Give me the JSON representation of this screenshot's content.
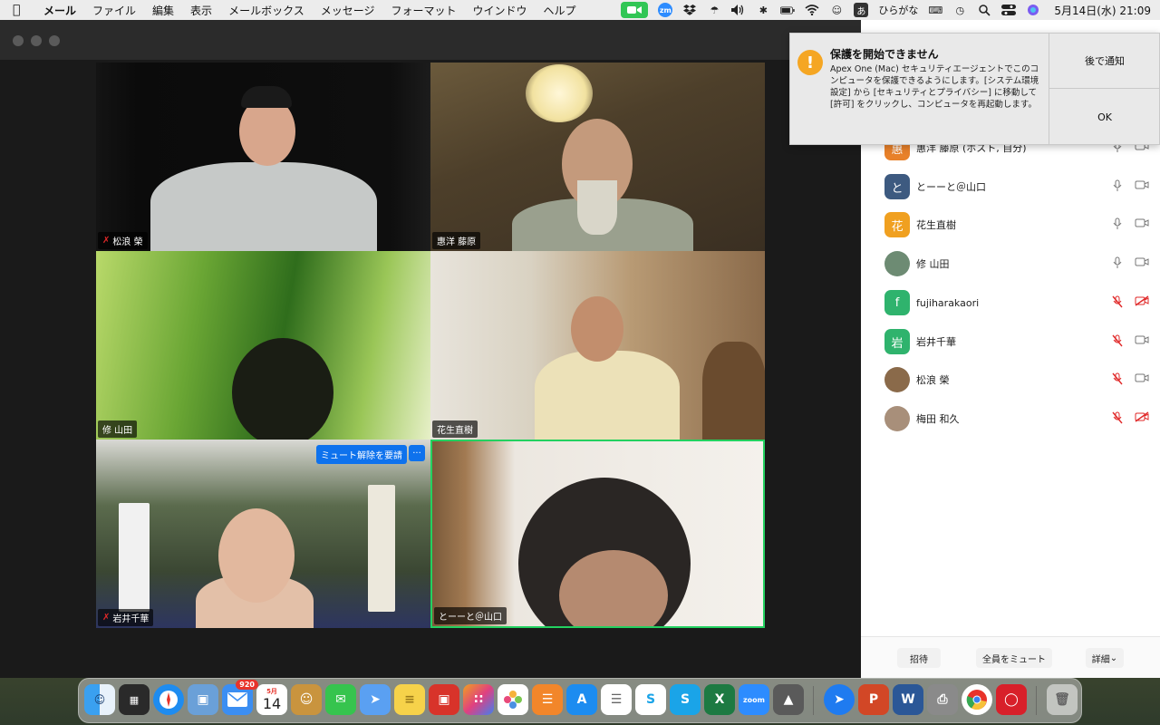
{
  "menubar": {
    "app": "メール",
    "items": [
      "ファイル",
      "編集",
      "表示",
      "メールボックス",
      "メッセージ",
      "フォーマット",
      "ウインドウ",
      "ヘルプ"
    ],
    "ime": "あ",
    "ime_label": "ひらがな",
    "zm": "zm",
    "datetime": "5月14日(水)  21:09"
  },
  "video": {
    "tiles": [
      {
        "name": "松浪 榮",
        "muted": true
      },
      {
        "name": "惠洋 藤原",
        "muted": false
      },
      {
        "name": "修 山田",
        "muted": false
      },
      {
        "name": "花生直樹",
        "muted": false
      },
      {
        "name": "岩井千華",
        "muted": true,
        "ask_unmute": "ミュート解除を要請",
        "more": "···"
      },
      {
        "name": "とーーと＠山口",
        "muted": false,
        "active": true
      }
    ]
  },
  "participants": [
    {
      "initial": "惠",
      "name": "惠洋 藤原 (ホスト, 自分)",
      "color": "#e8812a",
      "mic_muted": false,
      "cam_off": false
    },
    {
      "initial": "と",
      "name": "とーーと＠山口",
      "color": "#3d5a80",
      "mic_muted": false,
      "cam_off": false
    },
    {
      "initial": "花",
      "name": "花生直樹",
      "color": "#f0a020",
      "mic_muted": false,
      "cam_off": false
    },
    {
      "initial": "",
      "name": "修 山田",
      "color": "#6d8b73",
      "mic_muted": false,
      "cam_off": false
    },
    {
      "initial": "f",
      "name": "fujiharakaori",
      "color": "#2fb36d",
      "mic_muted": true,
      "cam_off": true
    },
    {
      "initial": "岩",
      "name": "岩井千華",
      "color": "#2fb36d",
      "mic_muted": true,
      "cam_off": false
    },
    {
      "initial": "",
      "name": "松浪 榮",
      "color": "#8a6a4a",
      "mic_muted": true,
      "cam_off": false
    },
    {
      "initial": "",
      "name": "梅田 和久",
      "color": "#a88f7a",
      "mic_muted": true,
      "cam_off": true
    }
  ],
  "panel_footer": {
    "invite": "招待",
    "mute_all": "全員をミュート",
    "more": "詳細"
  },
  "notification": {
    "title": "保護を開始できません",
    "body": "Apex One (Mac) セキュリティエージェントでこのコンピュータを保護できるようにします。[システム環境設定] から [セキュリティとプライバシー] に移動して [許可] をクリックし、コンピュータを再起動します。",
    "later": "後で通知",
    "ok": "OK"
  },
  "dock": {
    "mail_badge": "920",
    "calendar_month": "5月",
    "calendar_day": "14",
    "zoom_label": "zoom"
  },
  "colors": {
    "active_speaker": "#23d160",
    "zoom_blue": "#0e72ed",
    "muted_red": "#e02828",
    "warning": "#f5a623"
  }
}
